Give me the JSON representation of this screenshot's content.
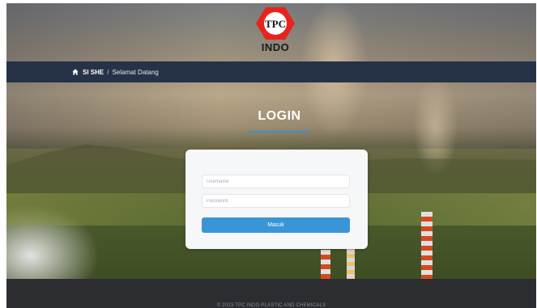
{
  "brand": {
    "logo_text": "INDO",
    "logo_mark": "TPC",
    "logo_color": "#e8231d"
  },
  "breadcrumb": {
    "home_icon": "home-icon",
    "home_label": "SI SHE",
    "separator": "/",
    "current": "Selamat Datang"
  },
  "login": {
    "title": "LOGIN",
    "username_placeholder": "Username",
    "password_placeholder": "Password",
    "submit_label": "Masuk",
    "accent_color": "#3a95d6"
  },
  "footer": {
    "copyright": "© 2023 TPC INDO PLASTIC AND CHEMICALS"
  }
}
